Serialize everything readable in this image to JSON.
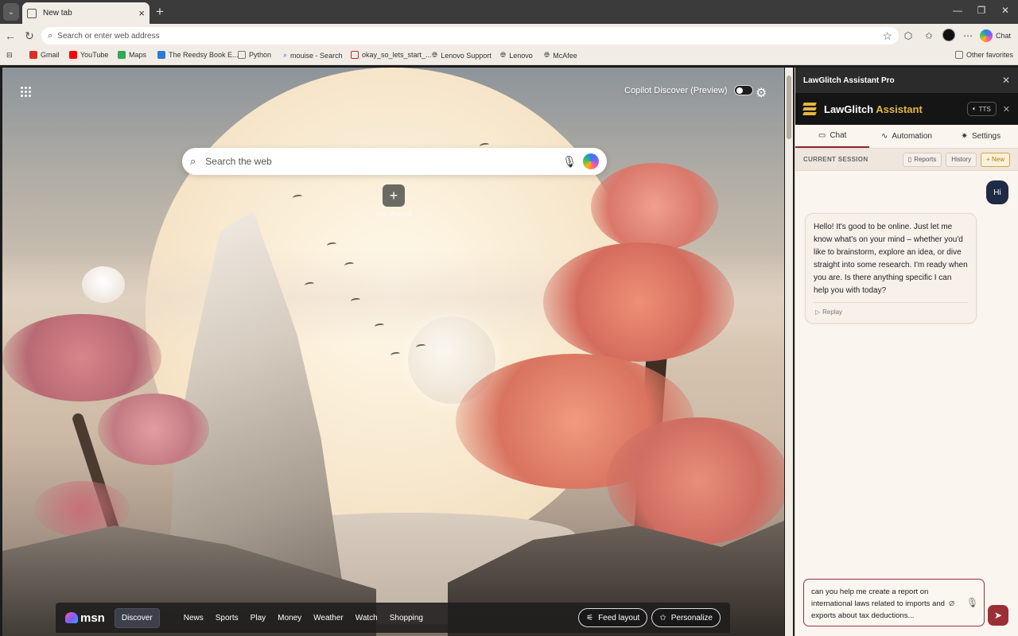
{
  "browser": {
    "tab_title": "New tab",
    "new_tab_glyph": "+",
    "address_placeholder": "Search or enter web address",
    "chat_label": "Chat"
  },
  "bookmarks": [
    {
      "label": "Gmail",
      "icon": "gmail-icon",
      "color": "#d93025"
    },
    {
      "label": "YouTube",
      "icon": "youtube-icon",
      "color": "#ff0000"
    },
    {
      "label": "Maps",
      "icon": "maps-icon",
      "color": "#34a853"
    },
    {
      "label": "The Reedsy Book E...",
      "icon": "reedsy-icon",
      "color": "#2b7bd3"
    },
    {
      "label": "Python",
      "icon": "folder-icon",
      "color": "#777777"
    },
    {
      "label": "mouise - Search",
      "icon": "search-icon",
      "color": "#2b5fb8"
    },
    {
      "label": "okay_so_lets_start_...",
      "icon": "pdf-icon",
      "color": "#c62828"
    },
    {
      "label": "Lenovo Support",
      "icon": "globe-icon",
      "color": "#444444"
    },
    {
      "label": "Lenovo",
      "icon": "globe-icon",
      "color": "#444444"
    },
    {
      "label": "McAfee",
      "icon": "globe-icon",
      "color": "#444444"
    }
  ],
  "other_favorites": "Other favorites",
  "newtab": {
    "copilot_discover": "Copilot Discover (Preview)",
    "search_placeholder": "Search the web",
    "add_shortcut": "Add shortcut",
    "msn": {
      "logo": "msn",
      "links": [
        "Discover",
        "News",
        "Sports",
        "Play",
        "Money",
        "Weather",
        "Watch",
        "Shopping"
      ],
      "active": "Discover",
      "feed_layout": "Feed layout",
      "personalize": "Personalize"
    }
  },
  "panel": {
    "title": "LawGlitch Assistant Pro",
    "brand_part1": "LawGlitch",
    "brand_part2": " Assistant",
    "tts": "TTS",
    "tabs": [
      {
        "label": "Chat",
        "icon": "chat-icon"
      },
      {
        "label": "Automation",
        "icon": "activity-icon"
      },
      {
        "label": "Settings",
        "icon": "gear-icon"
      }
    ],
    "session_label": "CURRENT SESSION",
    "buttons": {
      "reports": "Reports",
      "history": "History",
      "new": "+ New"
    },
    "user_message": "Hi",
    "bot_message": "Hello! It's good to be online. Just let me know what's on your mind – whether you'd like to brainstorm, explore an idea, or dive straight into some research. I'm ready when you are. Is there anything specific I can help you with today?",
    "replay": "Replay",
    "composer_text": "can you help me create a report on international laws related to imports and exports about tax deductions..."
  },
  "colors": {
    "accent_red": "#9b2f36",
    "brand_gold": "#e4b73e",
    "user_bubble": "#1f2a44"
  }
}
